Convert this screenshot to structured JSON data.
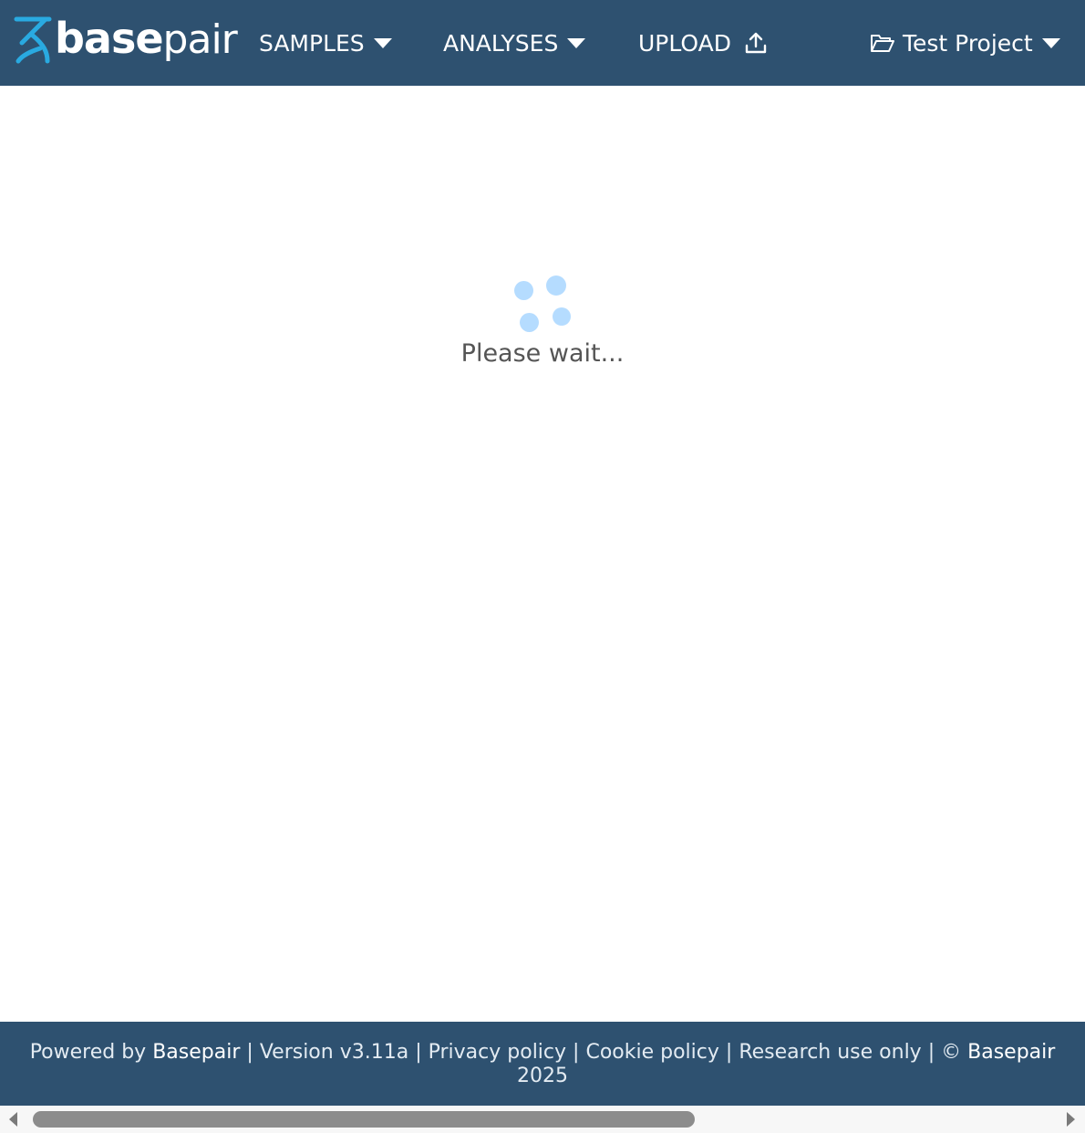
{
  "header": {
    "logo": {
      "bold": "base",
      "light": "pair"
    },
    "nav": {
      "samples": "SAMPLES",
      "analyses": "ANALYSES",
      "upload": "UPLOAD",
      "project": "Test Project"
    }
  },
  "main": {
    "loading_text": "Please wait..."
  },
  "footer": {
    "powered_by": "Powered by",
    "brand": "Basepair",
    "sep": "|",
    "version": "Version v3.11a",
    "privacy": "Privacy policy",
    "cookie": "Cookie policy",
    "research": "Research use only",
    "copyright_symbol": "©",
    "copyright_brand": "Basepair",
    "year": "2025"
  },
  "colors": {
    "navbar": "#2e5170",
    "logo_accent": "#29aae1",
    "spinner_dots": "#b5dcff",
    "loading_text": "#555555"
  },
  "icons": {
    "logo_mark": "dna-helix-icon",
    "samples_caret": "caret-down-icon",
    "analyses_caret": "caret-down-icon",
    "upload": "upload-icon",
    "project_folder": "folder-open-icon",
    "project_caret": "caret-down-icon"
  }
}
